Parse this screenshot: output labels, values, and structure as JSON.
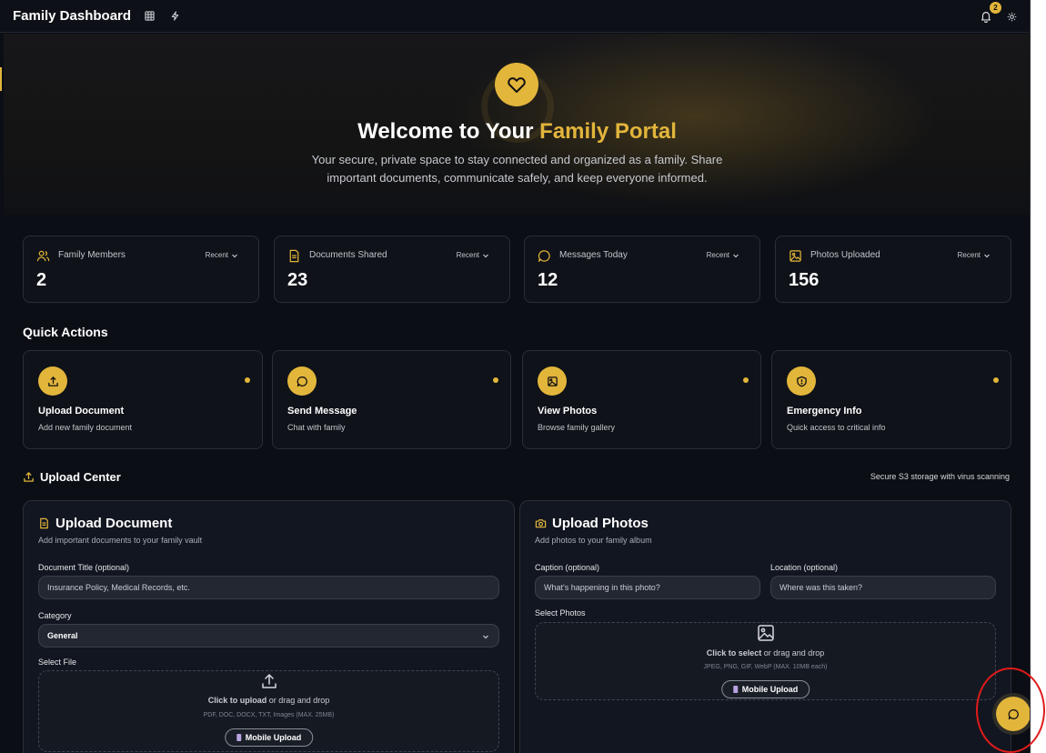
{
  "topbar": {
    "title": "Family Dashboard",
    "icons": [
      "grid-icon",
      "lightning-icon"
    ],
    "notification_count": "2"
  },
  "hero": {
    "title_prefix": "Welcome to Your ",
    "title_accent": "Family Portal",
    "subtitle": "Your secure, private space to stay connected and organized as a family. Share important documents, communicate safely, and keep everyone informed."
  },
  "stats": [
    {
      "label": "Family Members",
      "filter": "Recent",
      "value": "2",
      "icon": "users-icon"
    },
    {
      "label": "Documents Shared",
      "filter": "Recent",
      "value": "23",
      "icon": "document-icon"
    },
    {
      "label": "Messages Today",
      "filter": "Recent",
      "value": "12",
      "icon": "message-icon"
    },
    {
      "label": "Photos Uploaded",
      "filter": "Recent",
      "value": "156",
      "icon": "image-icon"
    }
  ],
  "quick_actions": {
    "title": "Quick Actions",
    "items": [
      {
        "title": "Upload Document",
        "desc": "Add new family document",
        "icon": "upload-icon"
      },
      {
        "title": "Send Message",
        "desc": "Chat with family",
        "icon": "message-icon"
      },
      {
        "title": "View Photos",
        "desc": "Browse family gallery",
        "icon": "image-icon"
      },
      {
        "title": "Emergency Info",
        "desc": "Quick access to critical info",
        "icon": "shield-icon"
      }
    ]
  },
  "upload_center": {
    "title": "Upload Center",
    "note": "Secure S3 storage with virus scanning",
    "document": {
      "title": "Upload Document",
      "subtitle": "Add important documents to your family vault",
      "doc_title_label": "Document Title (optional)",
      "doc_title_placeholder": "Insurance Policy, Medical Records, etc.",
      "category_label": "Category",
      "category_value": "General",
      "file_label": "Select File",
      "dz_action": "Click to upload",
      "dz_rest": " or drag and drop",
      "dz_hint": "PDF, DOC, DOCX, TXT, Images (MAX. 25MB)",
      "mobile_label": "Mobile Upload"
    },
    "photos": {
      "title": "Upload Photos",
      "subtitle": "Add photos to your family album",
      "caption_label": "Caption (optional)",
      "caption_placeholder": "What's happening in this photo?",
      "location_label": "Location (optional)",
      "location_placeholder": "Where was this taken?",
      "select_label": "Select Photos",
      "dz_action": "Click to select",
      "dz_rest": " or drag and drop",
      "dz_hint": "JPEG, PNG, GIF, WebP (MAX. 10MB each)",
      "mobile_label": "Mobile Upload"
    }
  },
  "colors": {
    "accent": "#e2b53b",
    "background": "#0b0e14",
    "card": "#0f1218",
    "annotation": "#e01b1b"
  }
}
